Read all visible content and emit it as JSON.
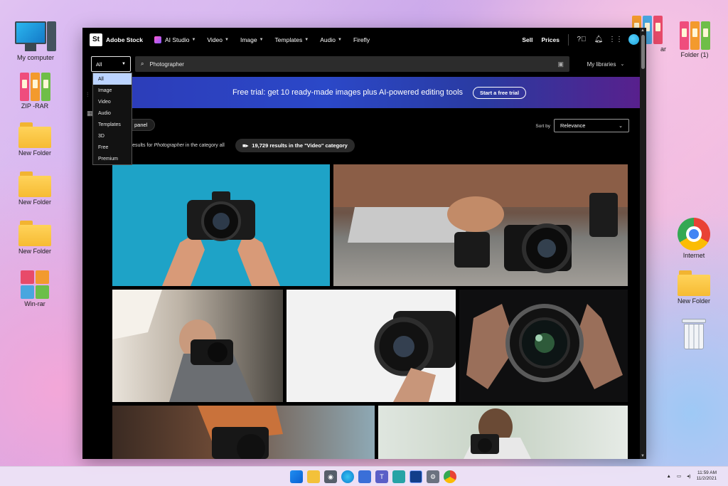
{
  "desktop": {
    "icons": {
      "my_computer": "My computer",
      "zip_rar": "ZIP -RAR",
      "new_folder_1": "New Folder",
      "new_folder_2": "New Folder",
      "new_folder_3": "New Folder",
      "win_rar": "Win-rar",
      "folder_top_right_partial": "ar",
      "folder_1": "Folder (1)",
      "internet": "Internet",
      "new_folder_right": "New Folder"
    }
  },
  "browser": {
    "topnav": {
      "logo": "St",
      "brand": "Adobe Stock",
      "items": [
        "AI Studio",
        "Video",
        "Image",
        "Templates",
        "Audio",
        "Firefly"
      ],
      "sell": "Sell",
      "prices": "Prices"
    },
    "search": {
      "category_selected": "All",
      "query": "Photographer",
      "my_libraries": "My libraries"
    },
    "category_dropdown": {
      "options": [
        "All",
        "Image",
        "Video",
        "Audio",
        "Templates",
        "3D",
        "Free",
        "Premium"
      ]
    },
    "banner": {
      "text": "Free trial: get 10 ready-made images plus AI-powered editing tools",
      "cta": "Start a free trial"
    },
    "controls": {
      "panel_button": "panel",
      "sort_label": "Sort by",
      "sort_value": "Relevance",
      "results_prefix": "4 results for ",
      "results_query": "Photographer",
      "results_suffix": " in the category all",
      "video_pill": "19,729 results in the \"Video\" category"
    }
  },
  "taskbar": {
    "time": "11:59 AM",
    "date": "11/2/2021"
  }
}
